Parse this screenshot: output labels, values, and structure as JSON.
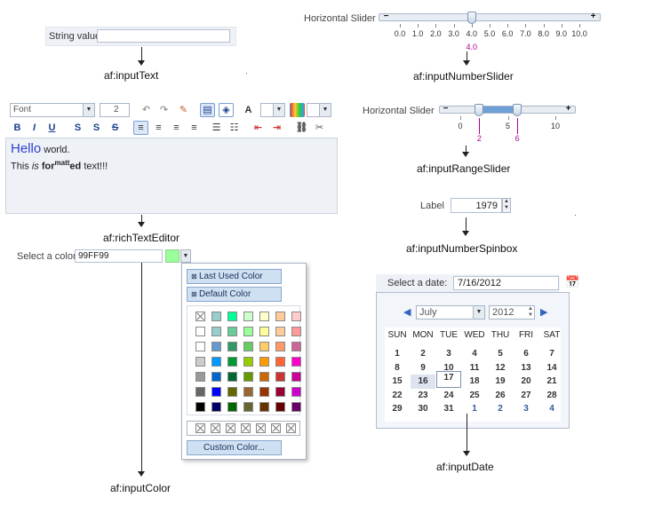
{
  "input_text": {
    "label": "String value",
    "value": "",
    "caption": "af:inputText"
  },
  "rich_text_editor": {
    "font_select": "Font",
    "size_select": "2",
    "line1_big": "Hello",
    "line1_rest": " world.",
    "line2_a": "This ",
    "line2_is": "is",
    "line2_for": " for",
    "line2_sup": "matt",
    "line2_ed": "ed",
    "line2_end": " text!!!",
    "toolbar": {
      "bold": "B",
      "italic": "I",
      "underline": "U",
      "subscript": "S",
      "superscript": "S",
      "strike": "S"
    },
    "caption": "af:richTextEditor"
  },
  "input_color": {
    "label": "Select a color",
    "value": "99FF99",
    "swatch_color": "#99ff99",
    "last_used": "Last Used Color",
    "default_color": "Default Color",
    "custom_color": "Custom Color...",
    "grid": [
      [
        "none",
        "#99cccc",
        "#00ff99",
        "#ccffcc",
        "#ffffcc",
        "#ffcc99",
        "#ffcccc"
      ],
      [
        "#ffffff",
        "#99cccc",
        "#66cc99",
        "#99ff99",
        "#ffff99",
        "#ffcc99",
        "#ff9999"
      ],
      [
        "#ffffff",
        "#6699cc",
        "#339966",
        "#66cc66",
        "#ffcc66",
        "#ff9966",
        "#cc6699"
      ],
      [
        "#cccccc",
        "#0099ff",
        "#009933",
        "#99cc00",
        "#ff9900",
        "#ff6633",
        "#ff00cc"
      ],
      [
        "#999999",
        "#0066cc",
        "#006633",
        "#669900",
        "#cc6600",
        "#cc3333",
        "#cc0099"
      ],
      [
        "#666666",
        "#0000ff",
        "#666600",
        "#996633",
        "#993300",
        "#990033",
        "#cc00cc"
      ],
      [
        "#000000",
        "#000066",
        "#006600",
        "#666633",
        "#663300",
        "#660000",
        "#660066"
      ]
    ],
    "recent_count": 7,
    "caption": "af:inputColor"
  },
  "number_slider": {
    "label": "Horizontal Slider",
    "ticks": [
      "0.0",
      "1.0",
      "2.0",
      "3.0",
      "4.0",
      "5.0",
      "6.0",
      "7.0",
      "8.0",
      "9.0",
      "10.0"
    ],
    "value": 4.0,
    "value_label": "4.0",
    "caption": "af:inputNumberSlider"
  },
  "range_slider": {
    "label": "Horizontal Slider",
    "ticks": [
      "0",
      "5",
      "10"
    ],
    "min_value": 2,
    "max_value": 6,
    "min_label": "2",
    "max_label": "6",
    "caption": "af:inputRangeSlider"
  },
  "spinbox": {
    "label": "Label",
    "value": "1979",
    "caption": "af:inputNumberSpinbox"
  },
  "input_date": {
    "label": "Select a date:",
    "value": "7/16/2012",
    "month": "July",
    "year": "2012",
    "weekdays": [
      "SUN",
      "MON",
      "TUE",
      "WED",
      "THU",
      "FRI",
      "SAT"
    ],
    "weeks": [
      [
        "1",
        "2",
        "3",
        "4",
        "5",
        "6",
        "7"
      ],
      [
        "8",
        "9",
        "10",
        "11",
        "12",
        "13",
        "14"
      ],
      [
        "15",
        "16",
        "17",
        "18",
        "19",
        "20",
        "21"
      ],
      [
        "22",
        "23",
        "24",
        "25",
        "26",
        "27",
        "28"
      ],
      [
        "29",
        "30",
        "31",
        "1",
        "2",
        "3",
        "4"
      ]
    ],
    "selected_day": "16",
    "today_day": "17",
    "caption": "af:inputDate"
  }
}
